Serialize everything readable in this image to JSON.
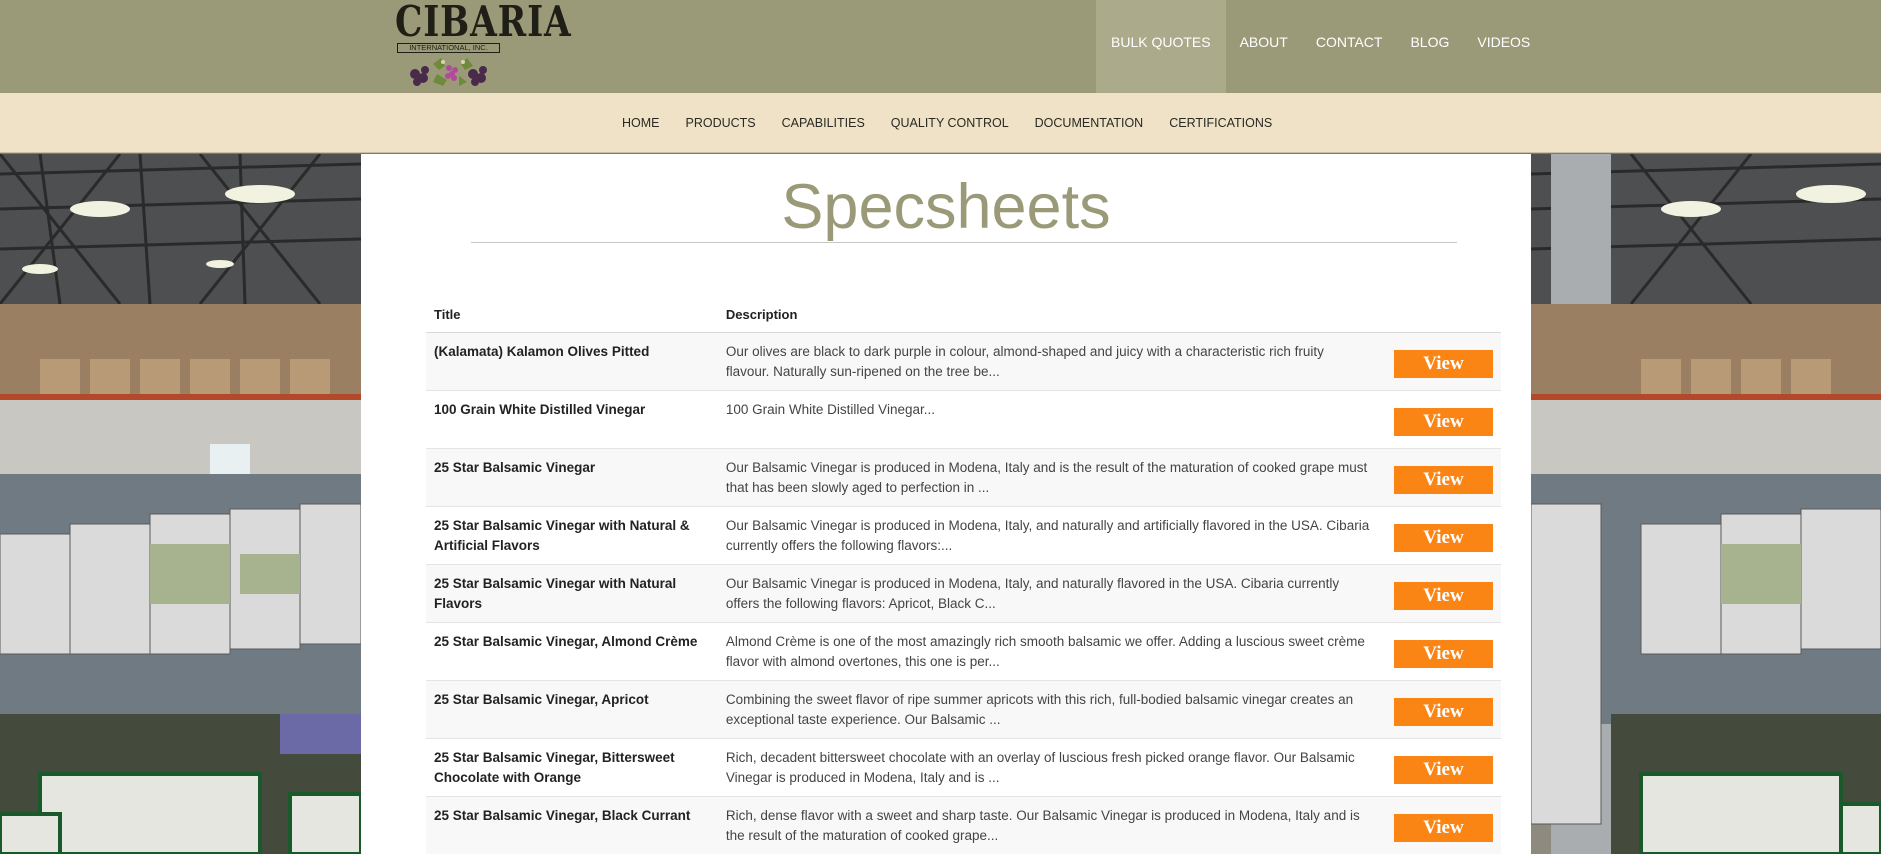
{
  "logo": {
    "brand": "CIBARIA",
    "sub": "INTERNATIONAL, INC."
  },
  "topnav": [
    {
      "label": "BULK QUOTES"
    },
    {
      "label": "ABOUT"
    },
    {
      "label": "CONTACT"
    },
    {
      "label": "BLOG"
    },
    {
      "label": "VIDEOS"
    }
  ],
  "subnav": [
    {
      "label": "HOME"
    },
    {
      "label": "PRODUCTS"
    },
    {
      "label": "CAPABILITIES"
    },
    {
      "label": "QUALITY CONTROL"
    },
    {
      "label": "DOCUMENTATION"
    },
    {
      "label": "CERTIFICATIONS"
    }
  ],
  "page": {
    "title": "Specsheets"
  },
  "table": {
    "headers": {
      "title": "Title",
      "description": "Description"
    },
    "view_label": "View",
    "rows": [
      {
        "title": "(Kalamata) Kalamon Olives Pitted",
        "description": "Our olives are black to dark purple in colour, almond-shaped and juicy with a characteristic rich fruity flavour. Naturally sun-ripened on the tree be..."
      },
      {
        "title": "100 Grain White Distilled Vinegar",
        "description": "100 Grain White Distilled Vinegar..."
      },
      {
        "title": "25 Star Balsamic Vinegar",
        "description": "Our Balsamic Vinegar is produced in Modena, Italy and is the result of the maturation of cooked grape must that has been slowly aged to perfection in ..."
      },
      {
        "title": "25 Star Balsamic Vinegar with Natural & Artificial Flavors",
        "description": "Our Balsamic Vinegar is produced in Modena, Italy, and naturally and artificially flavored in the USA. Cibaria currently offers the following flavors:..."
      },
      {
        "title": "25 Star Balsamic Vinegar with Natural Flavors",
        "description": "Our Balsamic Vinegar is produced in Modena, Italy, and naturally flavored in the USA. Cibaria currently offers the following flavors: Apricot, Black C..."
      },
      {
        "title": "25 Star Balsamic Vinegar, Almond Crème",
        "description": "Almond Crème is one of the most amazingly rich smooth balsamic we offer. Adding a luscious sweet crème flavor with almond overtones, this one is per..."
      },
      {
        "title": "25 Star Balsamic Vinegar, Apricot",
        "description": "Combining the sweet flavor of ripe summer apricots with this rich, full-bodied balsamic vinegar creates an exceptional taste experience. Our Balsamic ..."
      },
      {
        "title": "25 Star Balsamic Vinegar, Bittersweet Chocolate with Orange",
        "description": "Rich, decadent bittersweet chocolate with an overlay of luscious fresh picked orange flavor. Our Balsamic Vinegar is produced in Modena, Italy and is ..."
      },
      {
        "title": "25 Star Balsamic Vinegar, Black Currant",
        "description": "Rich, dense flavor with a sweet and sharp taste. Our Balsamic Vinegar is produced in Modena, Italy and is the result of the maturation of cooked grape..."
      }
    ]
  },
  "colors": {
    "header_bg": "#9b9a78",
    "subnav_bg": "#efe2c7",
    "title_color": "#9b9a78",
    "button_orange": "#fb8514"
  }
}
